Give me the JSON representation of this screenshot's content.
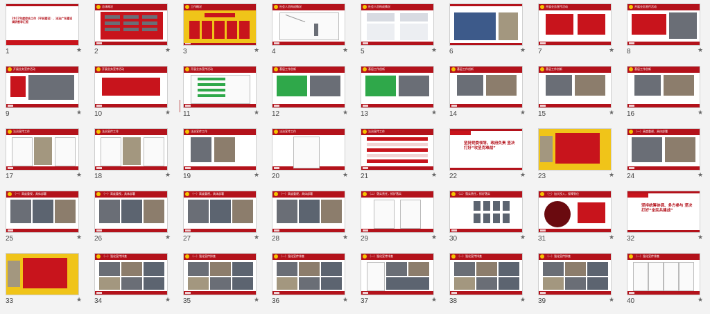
{
  "slides": [
    {
      "n": "1",
      "title": "",
      "text": "2017年度综合工作（平安建设）、法治广东建设调研督导汇报"
    },
    {
      "n": "2",
      "title": "总体概况",
      "text": ""
    },
    {
      "n": "3",
      "title": "工作概况",
      "text": ""
    },
    {
      "n": "4",
      "title": "社会人员构成情况",
      "text": ""
    },
    {
      "n": "5",
      "title": "社会人员构成情况",
      "text": "社会环境情况"
    },
    {
      "n": "6",
      "title": "",
      "text": ""
    },
    {
      "n": "7",
      "title": "开展业务宣传活动",
      "text": ""
    },
    {
      "n": "8",
      "title": "开展业务宣传活动",
      "text": ""
    },
    {
      "n": "9",
      "title": "开展业务宣传活动",
      "text": ""
    },
    {
      "n": "10",
      "title": "开展业务宣传活动",
      "text": ""
    },
    {
      "n": "11",
      "title": "开展业务宣传活动",
      "text": ""
    },
    {
      "n": "12",
      "title": "基层工作创新",
      "text": ""
    },
    {
      "n": "13",
      "title": "基层工作创新",
      "text": ""
    },
    {
      "n": "14",
      "title": "基层工作创新",
      "text": ""
    },
    {
      "n": "15",
      "title": "基层工作创新",
      "text": ""
    },
    {
      "n": "16",
      "title": "基层工作创新",
      "text": ""
    },
    {
      "n": "17",
      "title": "法治宣传工作",
      "text": ""
    },
    {
      "n": "18",
      "title": "法治宣传工作",
      "text": ""
    },
    {
      "n": "19",
      "title": "法治宣传工作",
      "text": ""
    },
    {
      "n": "20",
      "title": "法治宣传工作",
      "text": ""
    },
    {
      "n": "21",
      "title": "法治宣传工作",
      "text": ""
    },
    {
      "n": "22",
      "title": "",
      "text": "坚持党委领导，政府负责 坚决打好“攻坚克难战”"
    },
    {
      "n": "23",
      "title": "",
      "text": ""
    },
    {
      "n": "24",
      "title": "（一）高度重视，具体部署",
      "text": ""
    },
    {
      "n": "25",
      "title": "（一）高度重视，具体部署",
      "text": ""
    },
    {
      "n": "26",
      "title": "（一）高度重视，具体部署",
      "text": ""
    },
    {
      "n": "27",
      "title": "（一）高度重视，具体部署",
      "text": ""
    },
    {
      "n": "28",
      "title": "（一）高度重视，具体部署",
      "text": ""
    },
    {
      "n": "29",
      "title": "（二）落实责任，抓好落实",
      "text": ""
    },
    {
      "n": "30",
      "title": "（二）落实责任，抓好落实",
      "text": ""
    },
    {
      "n": "31",
      "title": "（三）加大投入，保障到位",
      "text": ""
    },
    {
      "n": "32",
      "title": "",
      "text": "坚持统筹协调、多方参与 坚决打好“全民共建战”"
    },
    {
      "n": "33",
      "title": "",
      "text": ""
    },
    {
      "n": "34",
      "title": "（一）强化宣传排查",
      "text": ""
    },
    {
      "n": "35",
      "title": "（一）强化宣传排查",
      "text": ""
    },
    {
      "n": "36",
      "title": "（一）强化宣传排查",
      "text": ""
    },
    {
      "n": "37",
      "title": "（一）强化宣传排查",
      "text": ""
    },
    {
      "n": "38",
      "title": "（一）强化宣传排查",
      "text": ""
    },
    {
      "n": "39",
      "title": "（一）强化宣传排查",
      "text": ""
    },
    {
      "n": "40",
      "title": "（一）强化宣传排查",
      "text": ""
    }
  ],
  "star_glyph": "★",
  "colors": {
    "brand": "#b3121b",
    "accent": "#f0c419",
    "green": "#2fa84a"
  }
}
